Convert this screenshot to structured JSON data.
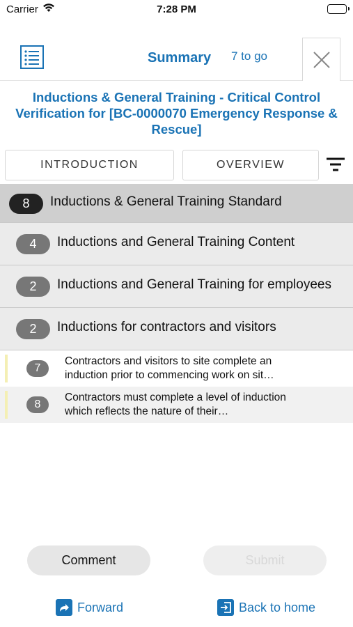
{
  "status_bar": {
    "carrier": "Carrier",
    "time": "7:28 PM",
    "battery_level": 1.0
  },
  "nav": {
    "title": "Summary",
    "remaining": "7 to go",
    "list_icon": "list-icon",
    "close_icon": "close-icon"
  },
  "heading": "Inductions & General Training - Critical Control Verification for [BC-0000070 Emergency Response & Rescue]",
  "tabs": {
    "introduction": "INTRODUCTION",
    "overview": "OVERVIEW",
    "filter_icon": "filter-icon"
  },
  "sections": [
    {
      "count": "8",
      "label": "Inductions & General Training Standard"
    },
    {
      "count": "4",
      "label": "Inductions and General Training Content"
    },
    {
      "count": "2",
      "label": "Inductions and General Training for employees"
    },
    {
      "count": "2",
      "label": "Inductions for contractors and visitors"
    }
  ],
  "questions": [
    {
      "number": "7",
      "text": "Contractors and visitors to site complete an induction prior to commencing work on sit…"
    },
    {
      "number": "8",
      "text": "Contractors must complete a level of induction which reflects the nature of their…"
    }
  ],
  "actions": {
    "comment": "Comment",
    "submit": "Submit",
    "forward": "Forward",
    "back_home": "Back to home"
  },
  "colors": {
    "accent": "#1a73b5",
    "section_header_bg": "#cfcfcf",
    "subsection_bg": "#ebebeb",
    "flag": "#f4efb4"
  }
}
